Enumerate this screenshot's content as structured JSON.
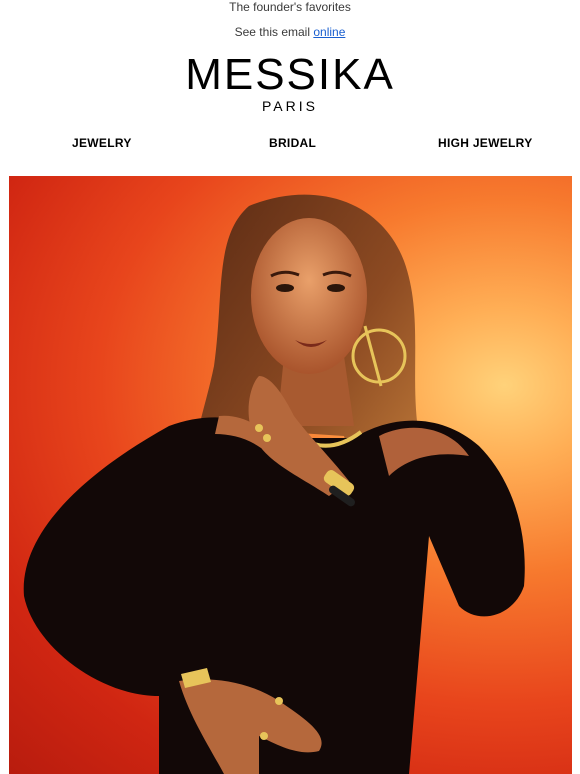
{
  "preheader": {
    "text": "The founder's favorites"
  },
  "view_online": {
    "prefix": "See this email",
    "link_label": "online"
  },
  "brand": {
    "name": "MESSIKA",
    "city": "PARIS"
  },
  "nav": {
    "items": [
      {
        "label": "JEWELRY"
      },
      {
        "label": "BRIDAL"
      },
      {
        "label": "HIGH JEWELRY"
      }
    ]
  },
  "hero": {
    "subject": "model-portrait-gold-jewelry",
    "background_colors": [
      "#b81c0e",
      "#e8451c",
      "#f77a2e",
      "#ffae55",
      "#ffd27a"
    ],
    "clothing_color": "#120807",
    "jewelry_color": "#e7c45a"
  }
}
